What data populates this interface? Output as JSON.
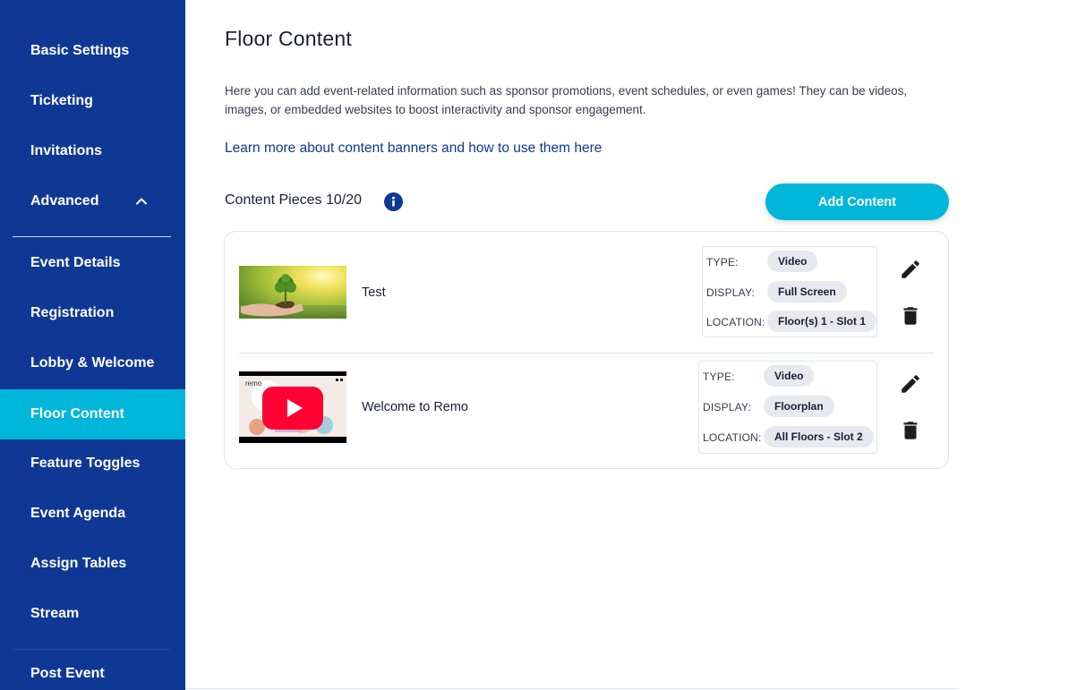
{
  "sidebar": {
    "items": [
      {
        "label": "Basic Settings",
        "active": false
      },
      {
        "label": "Ticketing",
        "active": false
      },
      {
        "label": "Invitations",
        "active": false
      },
      {
        "label": "Advanced",
        "active": false,
        "expanded": true,
        "icon": "chevron-up-icon"
      },
      {
        "label": "Event Details",
        "active": false
      },
      {
        "label": "Registration",
        "active": false
      },
      {
        "label": "Lobby & Welcome",
        "active": false
      },
      {
        "label": "Floor Content",
        "active": true
      },
      {
        "label": "Feature Toggles",
        "active": false
      },
      {
        "label": "Event Agenda",
        "active": false
      },
      {
        "label": "Assign Tables",
        "active": false
      },
      {
        "label": "Stream",
        "active": false
      },
      {
        "label": "Post Event",
        "active": false
      }
    ]
  },
  "main": {
    "title": "Floor Content",
    "intro": "Here you can add event-related information such as sponsor promotions, event schedules, or even games! They can be videos, images, or embedded websites to boost interactivity and sponsor engagement.",
    "learn_link": "Learn more about content banners and how to use them here",
    "pieces_label": "Content Pieces 10/20",
    "add_button": "Add Content",
    "meta_labels": {
      "type": "TYPE:",
      "display": "DISPLAY:",
      "location": "LOCATION:"
    },
    "items": [
      {
        "title": "Test",
        "thumbnail": "plant-in-hands-image",
        "type": "Video",
        "display": "Full Screen",
        "location": "Floor(s) 1 - Slot 1"
      },
      {
        "title": "Welcome to Remo",
        "thumbnail": "youtube-video-thumbnail",
        "thumbnail_text": "remo",
        "type": "Video",
        "display": "Floorplan",
        "location": "All Floors - Slot 2"
      }
    ]
  },
  "colors": {
    "sidebar_bg": "#0f3895",
    "active_item": "#00b6d9",
    "accent": "#00b6d9",
    "youtube_red": "#ff0033",
    "link": "#0f3895"
  },
  "icons": [
    "info-icon",
    "edit-icon",
    "trash-icon",
    "play-icon",
    "chevron-up-icon"
  ]
}
